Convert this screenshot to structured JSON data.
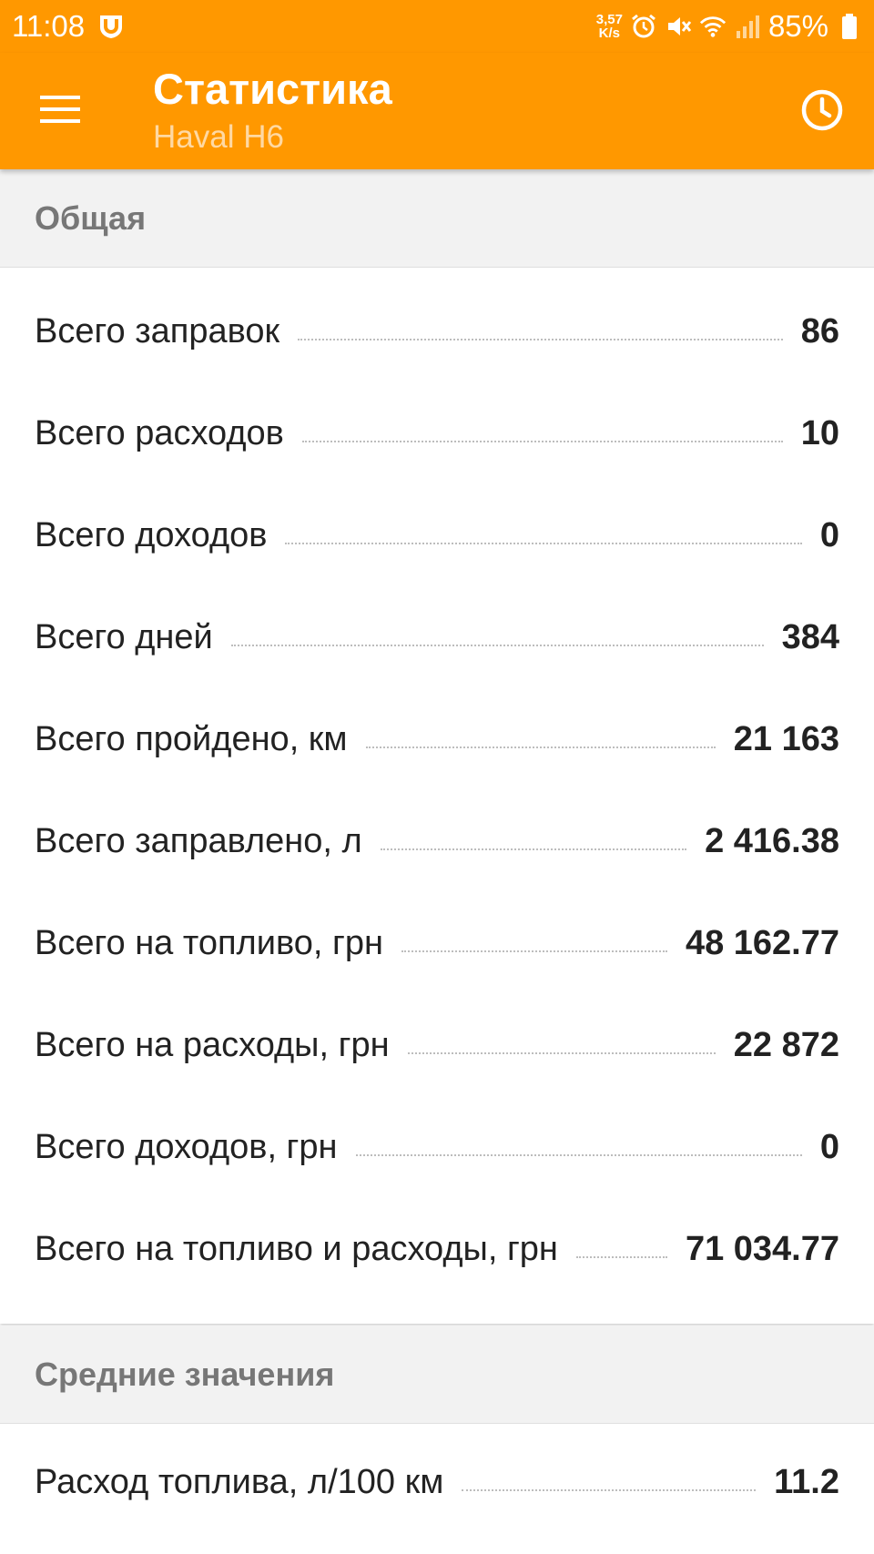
{
  "status_bar": {
    "time": "11:08",
    "net_speed_value": "3,57",
    "net_speed_unit": "K/s",
    "battery": "85%"
  },
  "app_bar": {
    "title": "Статистика",
    "subtitle": "Haval H6"
  },
  "colors": {
    "accent": "#FF9800",
    "section_bg": "#F2F2F2",
    "section_text": "#777777"
  },
  "sections": [
    {
      "header": "Общая",
      "rows": [
        {
          "label": "Всего заправок",
          "value": "86"
        },
        {
          "label": "Всего расходов",
          "value": "10"
        },
        {
          "label": "Всего доходов",
          "value": "0"
        },
        {
          "label": "Всего дней",
          "value": "384"
        },
        {
          "label": "Всего пройдено, км",
          "value": "21 163"
        },
        {
          "label": "Всего заправлено, л",
          "value": "2 416.38"
        },
        {
          "label": "Всего на топливо, грн",
          "value": "48 162.77"
        },
        {
          "label": "Всего на расходы, грн",
          "value": "22 872"
        },
        {
          "label": "Всего доходов, грн",
          "value": "0"
        },
        {
          "label": "Всего на топливо и расходы, грн",
          "value": "71 034.77"
        }
      ]
    },
    {
      "header": "Средние значения",
      "rows": [
        {
          "label": "Расход топлива, л/100 км",
          "value": "11.2"
        }
      ]
    }
  ]
}
